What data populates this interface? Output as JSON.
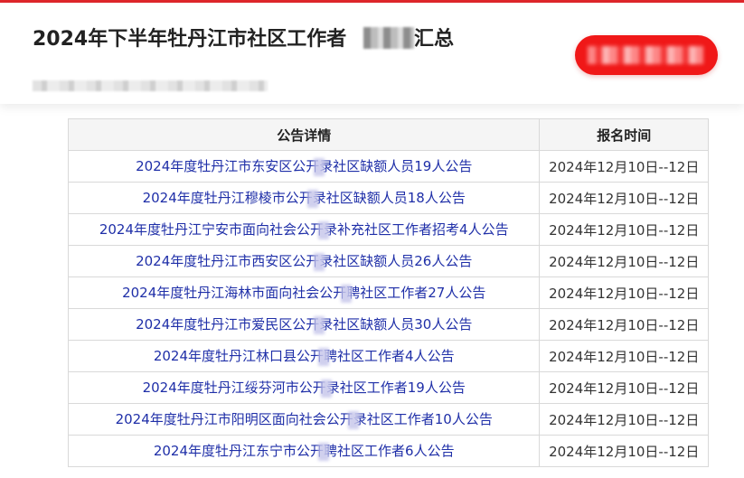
{
  "header": {
    "title": "2024年下半年牡丹江市社区工作者",
    "title_tail": "汇总",
    "accent_color": "#e0262b",
    "action_color": "#f01818"
  },
  "table": {
    "columns": [
      "公告详情",
      "报名时间"
    ],
    "rows": [
      {
        "title_a": "2024年度牡丹江市东安区公开",
        "title_b": "录社区缺额人员19人公告",
        "time": "2024年12月10日--12日"
      },
      {
        "title_a": "2024年度牡丹江穆棱市公开",
        "title_b": "录社区缺额人员18人公告",
        "time": "2024年12月10日--12日"
      },
      {
        "title_a": "2024年度牡丹江宁安市面向社会公开",
        "title_b": "录补充社区工作者招考4人公告",
        "time": "2024年12月10日--12日"
      },
      {
        "title_a": "2024年度牡丹江市西安区公开",
        "title_b": "录社区缺额人员26人公告",
        "time": "2024年12月10日--12日"
      },
      {
        "title_a": "2024年度牡丹江海林市面向社会公开",
        "title_b": "聘社区工作者27人公告",
        "time": "2024年12月10日--12日"
      },
      {
        "title_a": "2024年度牡丹江市爱民区公开",
        "title_b": "录社区缺额人员30人公告",
        "time": "2024年12月10日--12日"
      },
      {
        "title_a": "2024年度牡丹江林口县公开",
        "title_b": "聘社区工作者4人公告",
        "time": "2024年12月10日--12日"
      },
      {
        "title_a": "2024年度牡丹江绥芬河市公开",
        "title_b": "录社区工作者19人公告",
        "time": "2024年12月10日--12日"
      },
      {
        "title_a": "2024年度牡丹江市阳明区面向社会公开",
        "title_b": "录社区工作者10人公告",
        "time": "2024年12月10日--12日"
      },
      {
        "title_a": "2024年度牡丹江东宁市公开",
        "title_b": "聘社区工作者6人公告",
        "time": "2024年12月10日--12日"
      }
    ]
  }
}
